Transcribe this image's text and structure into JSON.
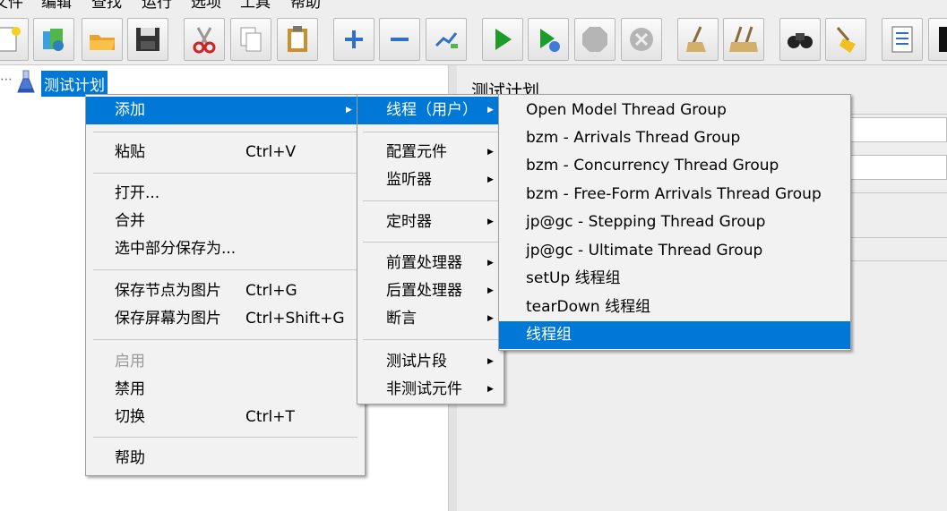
{
  "menubar": {
    "items": [
      "文件",
      "编辑",
      "查找",
      "运行",
      "选项",
      "工具",
      "帮助"
    ]
  },
  "toolbar": {
    "buttons": [
      {
        "name": "new-icon"
      },
      {
        "name": "templates-icon"
      },
      {
        "name": "open-icon"
      },
      {
        "name": "save-icon"
      },
      {
        "name": "cut-icon"
      },
      {
        "name": "copy-icon"
      },
      {
        "name": "paste-icon"
      },
      {
        "name": "expand-icon"
      },
      {
        "name": "collapse-icon"
      },
      {
        "name": "toggle-icon"
      },
      {
        "name": "start-icon"
      },
      {
        "name": "start-no-pause-icon"
      },
      {
        "name": "stop-icon"
      },
      {
        "name": "shutdown-icon"
      },
      {
        "name": "clear-icon"
      },
      {
        "name": "clear-all-icon"
      },
      {
        "name": "search-icon"
      },
      {
        "name": "reset-search-icon"
      },
      {
        "name": "function-helper-icon"
      },
      {
        "name": "help-icon"
      }
    ]
  },
  "tree": {
    "dots": "⋯",
    "node_label": "测试计划"
  },
  "right_panel": {
    "title": "测试计划"
  },
  "context_menu": {
    "add": "添加",
    "paste": "粘贴",
    "paste_shortcut": "Ctrl+V",
    "open": "打开...",
    "merge": "合并",
    "save_selection": "选中部分保存为...",
    "save_node_image": "保存节点为图片",
    "save_node_image_shortcut": "Ctrl+G",
    "save_screen_image": "保存屏幕为图片",
    "save_screen_image_shortcut": "Ctrl+Shift+G",
    "enable": "启用",
    "disable": "禁用",
    "toggle": "切换",
    "toggle_shortcut": "Ctrl+T",
    "help": "帮助"
  },
  "add_submenu": {
    "threads": "线程（用户）",
    "config_element": "配置元件",
    "listener": "监听器",
    "timer": "定时器",
    "pre_processor": "前置处理器",
    "post_processor": "后置处理器",
    "assertion": "断言",
    "test_fragment": "测试片段",
    "non_test_element": "非测试元件"
  },
  "threads_submenu": {
    "items": [
      "Open Model Thread Group",
      "bzm - Arrivals Thread Group",
      "bzm - Concurrency Thread Group",
      "bzm - Free-Form Arrivals Thread Group",
      "jp@gc - Stepping Thread Group",
      "jp@gc - Ultimate Thread Group",
      "setUp 线程组",
      "tearDown 线程组",
      "线程组"
    ]
  },
  "colors": {
    "highlight": "#0078d7",
    "menu_bg": "#f2f2f2",
    "disabled_text": "#9a9a9a"
  }
}
